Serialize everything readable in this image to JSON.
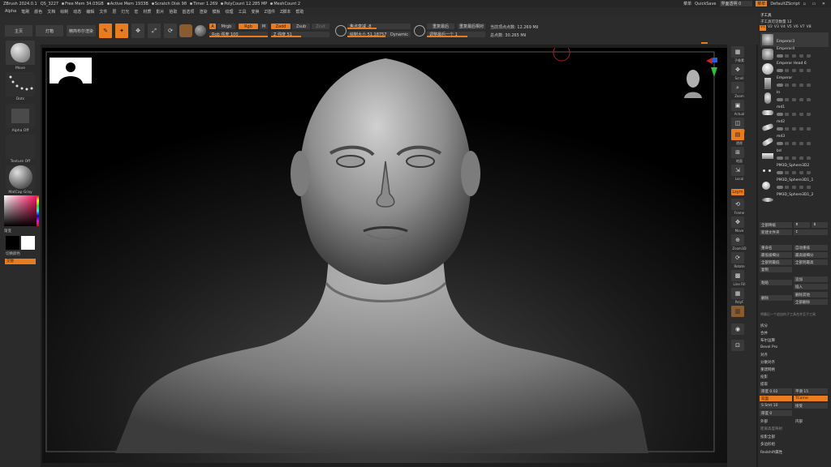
{
  "titlebar": {
    "app": "ZBrush 2024.0.1",
    "project": "QS_3227",
    "free_mem": "Free Mem 34.03GB",
    "active_mem": "Active Mem 1933B",
    "scratch": "Scratch Disk 98",
    "timer": "Timer 1.269",
    "polycount": "PolyCount 12.285 MP",
    "meshcount": "MeshCount 2",
    "menus_right": "菜单",
    "quicksave": "QuickSave",
    "transparency": "界面透明 0",
    "script": "DefaultZScript",
    "right_btn": "菜单"
  },
  "menubar": {
    "items": [
      "Alpha",
      "笔刷",
      "颜色",
      "文档",
      "绘制",
      "动态",
      "编辑",
      "文件",
      "层",
      "灯光",
      "宏",
      "材质",
      "影片",
      "拾取",
      "首选项",
      "渲染",
      "模板",
      "纹理",
      "工具",
      "变换",
      "Z插件",
      "Z脚本",
      "帮助"
    ]
  },
  "toolbar": {
    "home": "主页",
    "lightbox": "灯箱",
    "quick_sketch": "精简布尔渲染",
    "edit": "Edit",
    "draw": "Draw",
    "move": "Move",
    "scale": "Scale",
    "rotate": "Rotate",
    "a_btn": "A",
    "mrgb": "Mrgb",
    "rgb": "Rgb",
    "m": "M",
    "zadd": "Zadd",
    "zsub": "Zsub",
    "zcut": "Zcut",
    "rgb_intensity": "Rgb 强度 100",
    "z_intensity": "Z 强度 51",
    "focal_shift": "焦点衰减 -8",
    "draw_size": "绘制大小 51.18757",
    "dynamic": "Dynamic",
    "replay_last": "重复最后",
    "replay_last_rel": "重复最后相对",
    "adjust_last": "调整最后一个 1",
    "active_points": "当前顶点点数: 12.269 Mil",
    "total_points": "总点数: 30.265 Mil"
  },
  "leftshelf": {
    "brush": "Move",
    "stroke": "Dots",
    "alpha": "Alpha Off",
    "texture": "Texture Off",
    "material": "MatCap Gray",
    "gradient": "渐变",
    "switch_color": "切换颜色",
    "alternate": "交替"
  },
  "rightshelf": {
    "items": [
      "子像素",
      "Scroll",
      "Zoom",
      "Actual",
      "AAHalf",
      "透视",
      "地面",
      "Xpose",
      "Local",
      "Lsym",
      "Frame",
      "Move",
      "Zoom3D",
      "Rotate",
      "Line Fill",
      "PolyF",
      "Transp",
      "Ghost",
      "Solo",
      "Xpose"
    ]
  },
  "subtool": {
    "header": "子工具",
    "visible_count": "子工具可见数量 12",
    "tabs": [
      "V1",
      "V2",
      "V3",
      "V4",
      "V5",
      "V6",
      "V7",
      "V8"
    ],
    "items": [
      {
        "name": "Emperor3"
      },
      {
        "name": "Emperor4"
      },
      {
        "name": "Emperor Head 6"
      },
      {
        "name": "Emperor"
      },
      {
        "name": "In"
      },
      {
        "name": "md1"
      },
      {
        "name": "md2"
      },
      {
        "name": "md3"
      },
      {
        "name": "bd"
      },
      {
        "name": "PM3D_Sphere3D2"
      },
      {
        "name": "PM3D_Sphere3D1_1"
      },
      {
        "name": "PM3D_Sphere3D1_2"
      }
    ],
    "buttons": {
      "all_low": "全部降级",
      "new_folder": "新建文件夹",
      "rename": "重命名",
      "auto_reorder": "自动重排",
      "lowest_subdiv": "最低级细分",
      "highest_subdiv": "最高级细分",
      "all_to_low": "全部到最低",
      "all_to_high": "全部到最高",
      "copy": "复制",
      "paste": "粘贴",
      "add": "追加",
      "insert": "插入",
      "delete": "删除",
      "delete_others": "删除其他",
      "delete_all": "全部删除",
      "merge_hint": "将最后一个追加的子工具合并至子工具",
      "split": "拆分",
      "merge": "合并",
      "boolean": "布尔运算",
      "bevel_pro": "Bevel Pro",
      "align": "对齐",
      "distribute": "分散对齐",
      "remesh": "重建网格",
      "project": "投影",
      "extract": "提取",
      "extract_thick": "厚度 0.02",
      "smooth": "平滑 15",
      "double": "双面",
      "tcorne": "TCorne",
      "edge_smooth": "边缘平滑",
      "accept": "接受",
      "s_smt": "S Smt 10",
      "thick": "厚度 0",
      "surface_height": "表面高度 0",
      "external": "外部",
      "internal": "内部",
      "dist_height": "距离高度映射",
      "project_all": "投影全部",
      "poly_group": "多边形组",
      "redshift": "Redshift属性"
    }
  },
  "canvas": {
    "axis_colors": [
      "#d02020",
      "#2060e0",
      "#30c030"
    ]
  }
}
